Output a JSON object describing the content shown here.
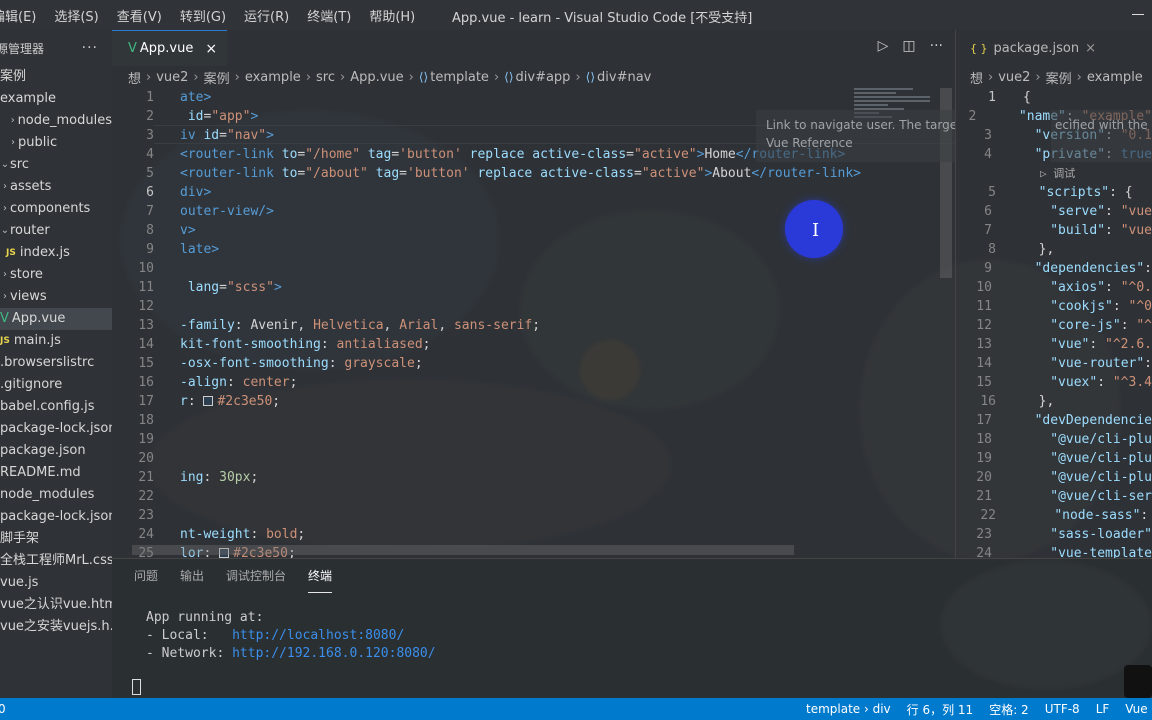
{
  "titlebar": {
    "menu": [
      "编辑(E)",
      "选择(S)",
      "查看(V)",
      "转到(G)",
      "运行(R)",
      "终端(T)",
      "帮助(H)"
    ],
    "window_title": "App.vue - learn - Visual Studio Code [不受支持]"
  },
  "explorer": {
    "title": "源管理器",
    "more": "···",
    "items": [
      {
        "label": "案例",
        "chev": ""
      },
      {
        "label": "example",
        "chev": ""
      },
      {
        "label": "node_modules",
        "chev": ">"
      },
      {
        "label": "public",
        "chev": ">"
      },
      {
        "label": "src",
        "chev": "v"
      },
      {
        "label": "assets",
        "chev": ">"
      },
      {
        "label": "components",
        "chev": ">"
      },
      {
        "label": "router",
        "chev": "v"
      },
      {
        "label": "index.js",
        "chev": "JS"
      },
      {
        "label": "store",
        "chev": ">"
      },
      {
        "label": "views",
        "chev": ">"
      },
      {
        "label": "App.vue",
        "chev": "V"
      },
      {
        "label": "main.js",
        "chev": "JS"
      },
      {
        "label": ".browserslistrc",
        "chev": ""
      },
      {
        "label": ".gitignore",
        "chev": ""
      },
      {
        "label": "babel.config.js",
        "chev": ""
      },
      {
        "label": "package-lock.json",
        "chev": ""
      },
      {
        "label": "package.json",
        "chev": ""
      },
      {
        "label": "README.md",
        "chev": ""
      },
      {
        "label": "node_modules",
        "chev": ""
      },
      {
        "label": "package-lock.json",
        "chev": ""
      },
      {
        "label": "脚手架",
        "chev": ""
      },
      {
        "label": "全栈工程师MrL.css",
        "chev": ""
      },
      {
        "label": "vue.js",
        "chev": ""
      },
      {
        "label": "vue之认识vue.html",
        "chev": ""
      },
      {
        "label": "vue之安装vuejs.h...",
        "chev": ""
      }
    ]
  },
  "editor": {
    "tab_label": "App.vue",
    "tab_close": "×",
    "breadcrumb": [
      "想",
      "vue2",
      "案例",
      "example",
      "src",
      "App.vue",
      "template",
      "div#app",
      "div#nav"
    ],
    "hover_text": "Link to navigate user. The target location is specified with the",
    "hover_text2": "Vue Reference",
    "lines": [
      {
        "n": "1",
        "html": "<span class='t-tag'>ate></span>"
      },
      {
        "n": "2",
        "html": " <span class='t-attr'>id</span>=<span class='t-str'>\"app\"</span><span class='t-tag'>></span>"
      },
      {
        "n": "3",
        "html": "<span class='t-tag'>iv </span><span class='t-attr'>id</span>=<span class='t-str'>\"nav\"</span><span class='t-tag'>></span>"
      },
      {
        "n": "4",
        "html": "<span class='t-tag'>&lt;router-link </span><span class='t-attr'>to</span>=<span class='t-str'>\"/home\"</span> <span class='t-attr'>tag</span>=<span class='t-str'>'button'</span> <span class='t-attr'>replace active-class</span>=<span class='t-str'>\"active\"</span><span class='t-tag'>></span>Home<span class='t-tag'>&lt;/router-link></span>"
      },
      {
        "n": "5",
        "html": "<span class='t-tag'>&lt;router-link </span><span class='t-attr'>to</span>=<span class='t-str'>\"/about\"</span> <span class='t-attr'>tag</span>=<span class='t-str'>'button'</span> <span class='t-attr'>replace active-class</span>=<span class='t-str'>\"active\"</span><span class='t-tag'>></span>About<span class='t-tag'>&lt;/router-link></span>"
      },
      {
        "n": "6",
        "html": "<span class='t-tag'>div></span>"
      },
      {
        "n": "7",
        "html": "<span class='t-tag'>outer-view/></span>"
      },
      {
        "n": "8",
        "html": "<span class='t-tag'>v></span>"
      },
      {
        "n": "9",
        "html": "<span class='t-tag'>late></span>"
      },
      {
        "n": "10",
        "html": ""
      },
      {
        "n": "11",
        "html": " <span class='t-attr'>lang</span>=<span class='t-str'>\"scss\"</span><span class='t-tag'>></span>"
      },
      {
        "n": "12",
        "html": ""
      },
      {
        "n": "13",
        "html": "<span class='t-prop'>-family</span>: Avenir, <span class='t-val'>Helvetica</span>, <span class='t-val'>Arial</span>, <span class='t-val'>sans-serif</span>;"
      },
      {
        "n": "14",
        "html": "<span class='t-prop'>kit-font-smoothing</span>: <span class='t-val'>antialiased</span>;"
      },
      {
        "n": "15",
        "html": "<span class='t-prop'>-osx-font-smoothing</span>: <span class='t-val'>grayscale</span>;"
      },
      {
        "n": "16",
        "html": "<span class='t-prop'>-align</span>: <span class='t-val'>center</span>;"
      },
      {
        "n": "17",
        "html": "<span class='t-prop'>r</span>: <span class='color-box' style='background:#2c3e50'></span><span class='t-val'>#2c3e50</span>;"
      },
      {
        "n": "18",
        "html": ""
      },
      {
        "n": "19",
        "html": ""
      },
      {
        "n": "20",
        "html": ""
      },
      {
        "n": "21",
        "html": "<span class='t-prop'>ing</span>: <span class='t-num'>30px</span>;"
      },
      {
        "n": "22",
        "html": ""
      },
      {
        "n": "23",
        "html": ""
      },
      {
        "n": "24",
        "html": "<span class='t-prop'>nt-weight</span>: <span class='t-val'>bold</span>;"
      },
      {
        "n": "25",
        "html": "<span class='t-prop'>lor</span>: <span class='color-box' style='background:#2c3e50'></span><span class='t-val'>#2c3e50</span>;"
      }
    ],
    "current_line": "6"
  },
  "right_editor": {
    "tab_label": "package.json",
    "tab_close": "×",
    "breadcrumb": [
      "想",
      "vue2",
      "案例",
      "example"
    ],
    "hover_text": "ecified with the",
    "codelens": "▷ 调试",
    "lines": [
      {
        "n": "1",
        "html": "{"
      },
      {
        "n": "2",
        "html": "  <span class='j-key'>\"name\"</span>: <span class='j-str'>\"example\"</span>"
      },
      {
        "n": "3",
        "html": "  <span class='j-key'>\"version\"</span>: <span class='j-str'>\"0.1</span>"
      },
      {
        "n": "4",
        "html": "  <span class='j-key'>\"private\"</span>: <span class='t-tag'>true</span>"
      },
      {
        "n": "5",
        "html": "  <span class='j-key'>\"scripts\"</span>: {"
      },
      {
        "n": "6",
        "html": "    <span class='j-key'>\"serve\"</span>: <span class='j-str'>\"vue</span>"
      },
      {
        "n": "7",
        "html": "    <span class='j-key'>\"build\"</span>: <span class='j-str'>\"vue</span>"
      },
      {
        "n": "8",
        "html": "  },"
      },
      {
        "n": "9",
        "html": "  <span class='j-key'>\"dependencies\"</span>:"
      },
      {
        "n": "10",
        "html": "    <span class='j-key'>\"axios\"</span>: <span class='j-str'>\"^0.</span>"
      },
      {
        "n": "11",
        "html": "    <span class='j-key'>\"cookjs\"</span>: <span class='j-str'>\"^0</span>"
      },
      {
        "n": "12",
        "html": "    <span class='j-key'>\"core-js\"</span>: <span class='j-str'>\"^</span>"
      },
      {
        "n": "13",
        "html": "    <span class='j-key'>\"vue\"</span>: <span class='j-str'>\"^2.6.</span>"
      },
      {
        "n": "14",
        "html": "    <span class='j-key'>\"vue-router\"</span>:"
      },
      {
        "n": "15",
        "html": "    <span class='j-key'>\"vuex\"</span>: <span class='j-str'>\"^3.4</span>"
      },
      {
        "n": "16",
        "html": "  },"
      },
      {
        "n": "17",
        "html": "  <span class='j-key'>\"devDependencie</span>"
      },
      {
        "n": "18",
        "html": "    <span class='j-key'>\"@vue/cli-plu</span>"
      },
      {
        "n": "19",
        "html": "    <span class='j-key'>\"@vue/cli-plu</span>"
      },
      {
        "n": "20",
        "html": "    <span class='j-key'>\"@vue/cli-plu</span>"
      },
      {
        "n": "21",
        "html": "    <span class='j-key'>\"@vue/cli-ser</span>"
      },
      {
        "n": "22",
        "html": "    <span class='j-key'>\"node-sass\"</span>:"
      },
      {
        "n": "23",
        "html": "    <span class='j-key'>\"sass-loader\"</span>"
      },
      {
        "n": "24",
        "html": "    <span class='j-key'>\"vue-template</span>"
      }
    ]
  },
  "panel": {
    "tabs": [
      "问题",
      "输出",
      "调试控制台",
      "终端"
    ],
    "active_tab": "终端",
    "terminal_lines": [
      {
        "text": "App running at:",
        "url": ""
      },
      {
        "text": "- Local:   ",
        "url": "http://localhost:8080/"
      },
      {
        "text": "- Network: ",
        "url": "http://192.168.0.120:8080/"
      }
    ]
  },
  "statusbar": {
    "left": "0",
    "items": [
      "template › div",
      "行 6，列 11",
      "空格: 2",
      "UTF-8",
      "LF",
      "Vue"
    ]
  },
  "colors": {
    "accent": "#007acc",
    "cursor_dot": "#2a3ad8"
  }
}
